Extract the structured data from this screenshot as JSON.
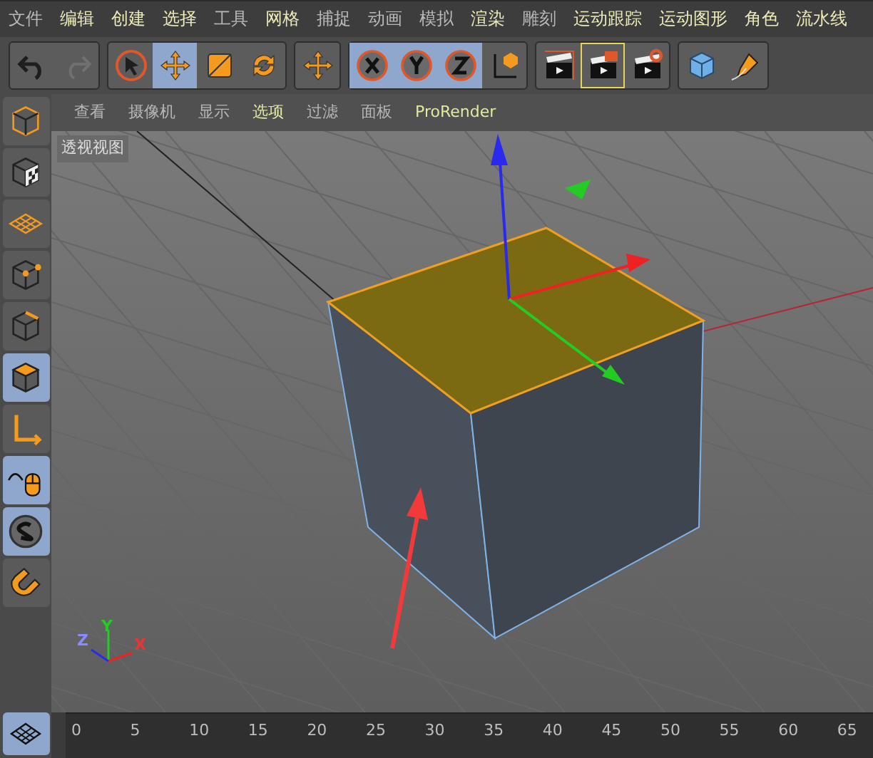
{
  "menu": [
    {
      "label": "文件",
      "highlighted": false
    },
    {
      "label": "编辑",
      "highlighted": true
    },
    {
      "label": "创建",
      "highlighted": true
    },
    {
      "label": "选择",
      "highlighted": true
    },
    {
      "label": "工具",
      "highlighted": false
    },
    {
      "label": "网格",
      "highlighted": true
    },
    {
      "label": "捕捉",
      "highlighted": false
    },
    {
      "label": "动画",
      "highlighted": false
    },
    {
      "label": "模拟",
      "highlighted": false
    },
    {
      "label": "渲染",
      "highlighted": true
    },
    {
      "label": "雕刻",
      "highlighted": false
    },
    {
      "label": "运动跟踪",
      "highlighted": true
    },
    {
      "label": "运动图形",
      "highlighted": true
    },
    {
      "label": "角色",
      "highlighted": true
    },
    {
      "label": "流水线",
      "highlighted": true
    }
  ],
  "toolbar": [
    [
      {
        "selected": false,
        "disabled": false
      },
      {
        "selected": false,
        "disabled": true
      }
    ],
    [
      {
        "selected": false,
        "disabled": false
      },
      {
        "selected": true,
        "disabled": false
      },
      {
        "selected": false,
        "disabled": false
      },
      {
        "selected": false,
        "disabled": false
      }
    ],
    [
      {
        "selected": false,
        "disabled": false
      }
    ],
    [
      {
        "selected": true,
        "disabled": false
      },
      {
        "selected": true,
        "disabled": false
      },
      {
        "selected": true,
        "disabled": false
      },
      {
        "selected": false,
        "disabled": false
      }
    ],
    [
      {
        "selected": false,
        "disabled": false
      },
      {
        "selected": true,
        "disabled": false
      },
      {
        "selected": false,
        "disabled": false
      }
    ],
    [
      {
        "selected": false,
        "disabled": false
      },
      {
        "selected": false,
        "disabled": false
      }
    ]
  ],
  "viewport_menu": [
    {
      "label": "查看",
      "highlighted": false
    },
    {
      "label": "摄像机",
      "highlighted": false
    },
    {
      "label": "显示",
      "highlighted": false
    },
    {
      "label": "选项",
      "highlighted": true
    },
    {
      "label": "过滤",
      "highlighted": false
    },
    {
      "label": "面板",
      "highlighted": false
    },
    {
      "label": "ProRender",
      "highlighted": true
    }
  ],
  "viewport": {
    "label": "透视视图",
    "axis_labels": [
      "Y",
      "Z",
      "X"
    ]
  },
  "left_toolbar": [
    {
      "selected": false
    },
    {
      "selected": false
    },
    {
      "selected": false
    },
    {
      "selected": false
    },
    {
      "selected": false
    },
    {
      "selected": true
    },
    {
      "selected": false
    },
    {
      "selected": true
    },
    {
      "selected": true
    },
    {
      "selected": false
    },
    {
      "selected": true
    }
  ],
  "timeline": {
    "ticks": [
      "0",
      "5",
      "10",
      "15",
      "20",
      "25",
      "30",
      "35",
      "40",
      "45",
      "50",
      "55",
      "60",
      "65"
    ]
  }
}
